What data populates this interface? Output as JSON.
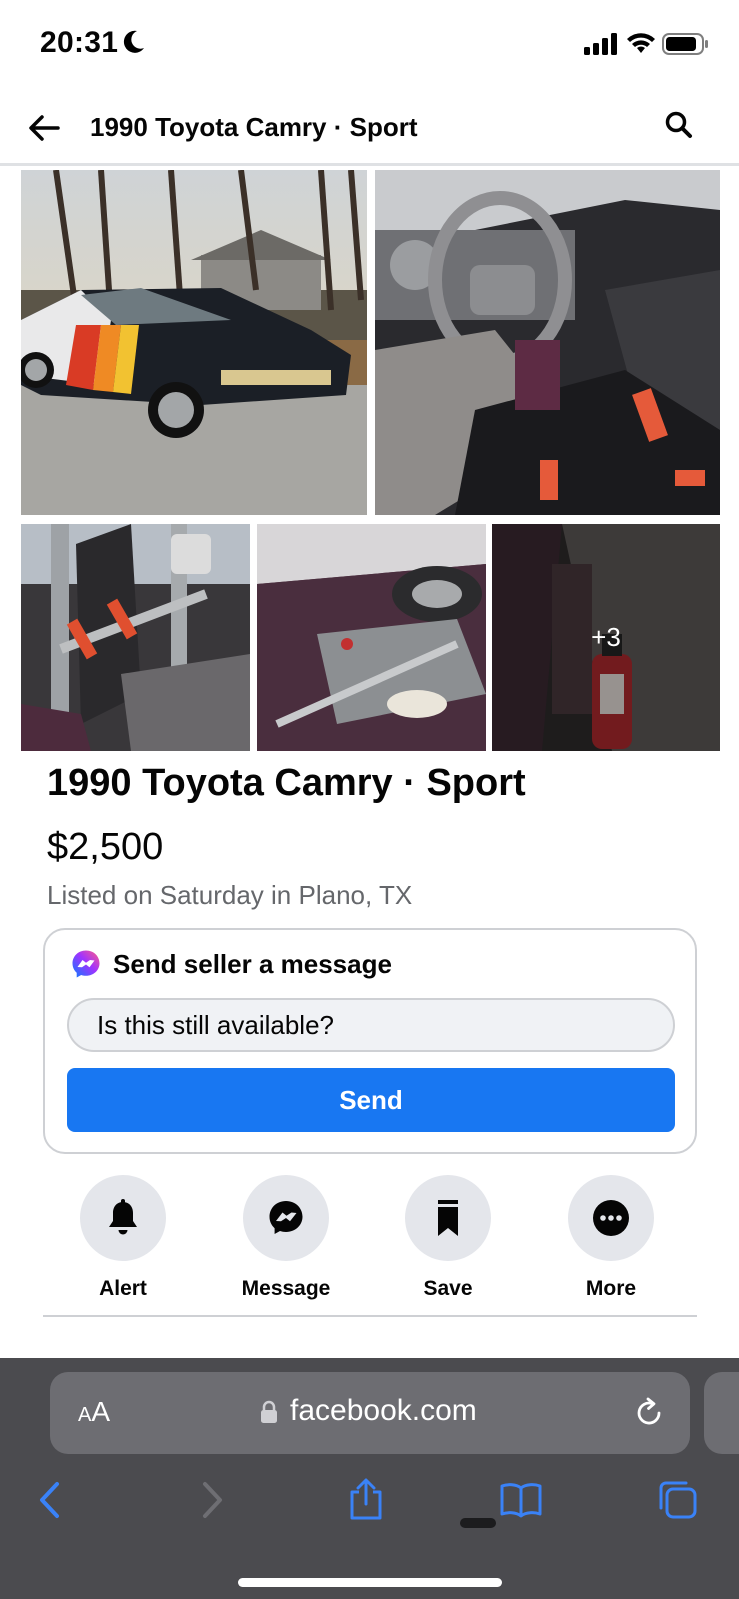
{
  "status_bar": {
    "time": "20:31"
  },
  "header": {
    "title": "1990 Toyota Camry · Sport"
  },
  "photos": {
    "more_count_label": "+3"
  },
  "listing": {
    "title": "1990 Toyota Camry · Sport",
    "price": "$2,500",
    "meta": "Listed on Saturday in Plano, TX"
  },
  "message_card": {
    "header": "Send seller a message",
    "input_value": "Is this still available?",
    "send_label": "Send"
  },
  "actions": [
    {
      "label": "Alert",
      "icon": "bell-icon"
    },
    {
      "label": "Message",
      "icon": "messenger-icon"
    },
    {
      "label": "Save",
      "icon": "bookmark-icon"
    },
    {
      "label": "More",
      "icon": "more-icon"
    }
  ],
  "browser": {
    "aa_small": "A",
    "aa_large": "A",
    "url": "facebook.com"
  },
  "colors": {
    "accent": "#1877f2",
    "secondary_text": "#65676b",
    "browser_bg": "#4b4b4f",
    "nav_blue": "#3a82f7"
  }
}
